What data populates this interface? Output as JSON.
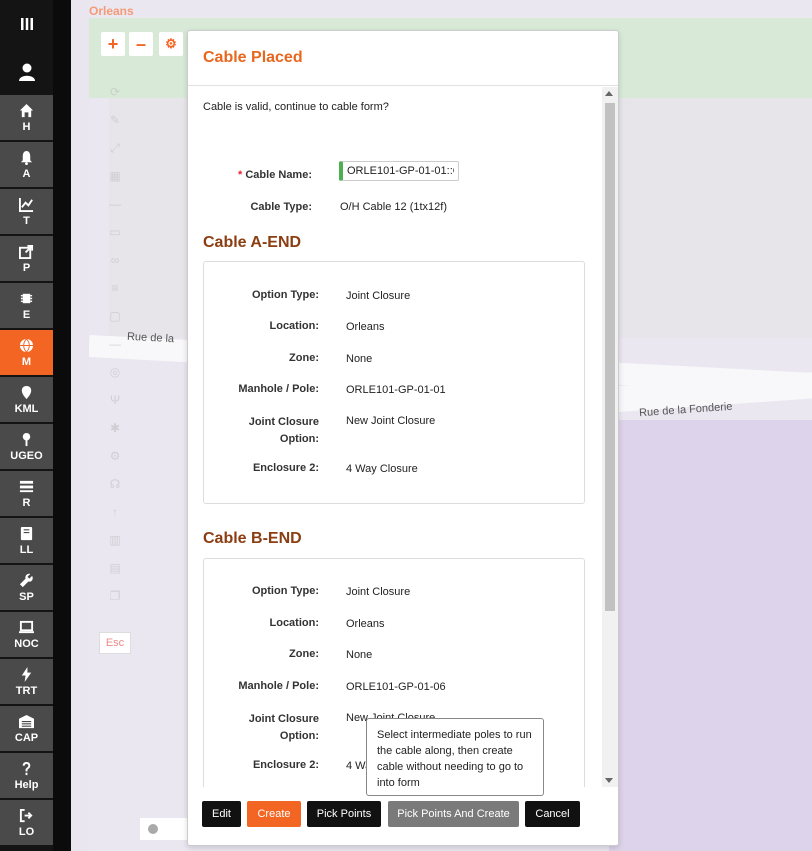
{
  "sidebar": {
    "menu_icon": "menu-icon",
    "user_icon": "user-icon",
    "items": [
      {
        "label": "H",
        "icon": "home-icon",
        "active": false
      },
      {
        "label": "A",
        "icon": "bell-icon",
        "active": false
      },
      {
        "label": "T",
        "icon": "chart-icon",
        "active": false
      },
      {
        "label": "P",
        "icon": "share-icon",
        "active": false
      },
      {
        "label": "E",
        "icon": "chip-icon",
        "active": false
      },
      {
        "label": "M",
        "icon": "globe-icon",
        "active": true
      },
      {
        "label": "KML",
        "icon": "pin-icon",
        "active": false
      },
      {
        "label": "UGEO",
        "icon": "map-pin-icon",
        "active": false
      },
      {
        "label": "R",
        "icon": "list-icon",
        "active": false
      },
      {
        "label": "LL",
        "icon": "book-icon",
        "active": false
      },
      {
        "label": "SP",
        "icon": "wrench-icon",
        "active": false
      },
      {
        "label": "NOC",
        "icon": "monitor-icon",
        "active": false
      },
      {
        "label": "TRT",
        "icon": "bolt-icon",
        "active": false
      },
      {
        "label": "CAP",
        "icon": "warehouse-icon",
        "active": false
      },
      {
        "label": "Help",
        "icon": "question-icon",
        "active": false
      },
      {
        "label": "LO",
        "icon": "logout-icon",
        "active": false
      }
    ]
  },
  "map": {
    "area_label": "Orleans",
    "road_label_1": "Rue de la",
    "road_label_2": "Rue de la Fonderie",
    "zoom_in": "+",
    "zoom_out": "–",
    "esc_label": "Esc"
  },
  "modal": {
    "title": "Cable Placed",
    "valid_message": "Cable is valid, continue to cable form?",
    "cable_name_label": "Cable Name:",
    "cable_name_required": "*",
    "cable_name_value": "ORLE101-GP-01-01::O",
    "cable_type_label": "Cable Type:",
    "cable_type_value": "O/H Cable 12 (1tx12f)",
    "a_end": {
      "title": "Cable A-END",
      "option_type_label": "Option Type:",
      "option_type": "Joint Closure",
      "location_label": "Location:",
      "location": "Orleans",
      "zone_label": "Zone:",
      "zone": "None",
      "manhole_label": "Manhole / Pole:",
      "manhole": "ORLE101-GP-01-01",
      "jc_label_1": "Joint Closure",
      "jc_label_2": "Option:",
      "jc_option": "New Joint Closure",
      "enclosure_label": "Enclosure 2:",
      "enclosure": "4 Way Closure"
    },
    "b_end": {
      "title": "Cable B-END",
      "option_type_label": "Option Type:",
      "option_type": "Joint Closure",
      "location_label": "Location:",
      "location": "Orleans",
      "zone_label": "Zone:",
      "zone": "None",
      "manhole_label": "Manhole / Pole:",
      "manhole": "ORLE101-GP-01-06",
      "jc_label_1": "Joint Closure",
      "jc_label_2": "Option:",
      "jc_option": "New Joint Closure",
      "enclosure_label": "Enclosure 2:",
      "enclosure": "4 Wa"
    },
    "buttons": {
      "edit": "Edit",
      "create": "Create",
      "pick_points": "Pick Points",
      "pick_points_create": "Pick Points And Create",
      "cancel": "Cancel"
    },
    "tooltip": "Select intermediate poles to run the cable along, then create cable without needing to go to into form"
  },
  "colors": {
    "accent": "#f26522",
    "section_title": "#8b3e12",
    "sidebar_bg": "#4a4a4a",
    "button_dark": "#111111",
    "button_grey": "#7a7a7a"
  }
}
